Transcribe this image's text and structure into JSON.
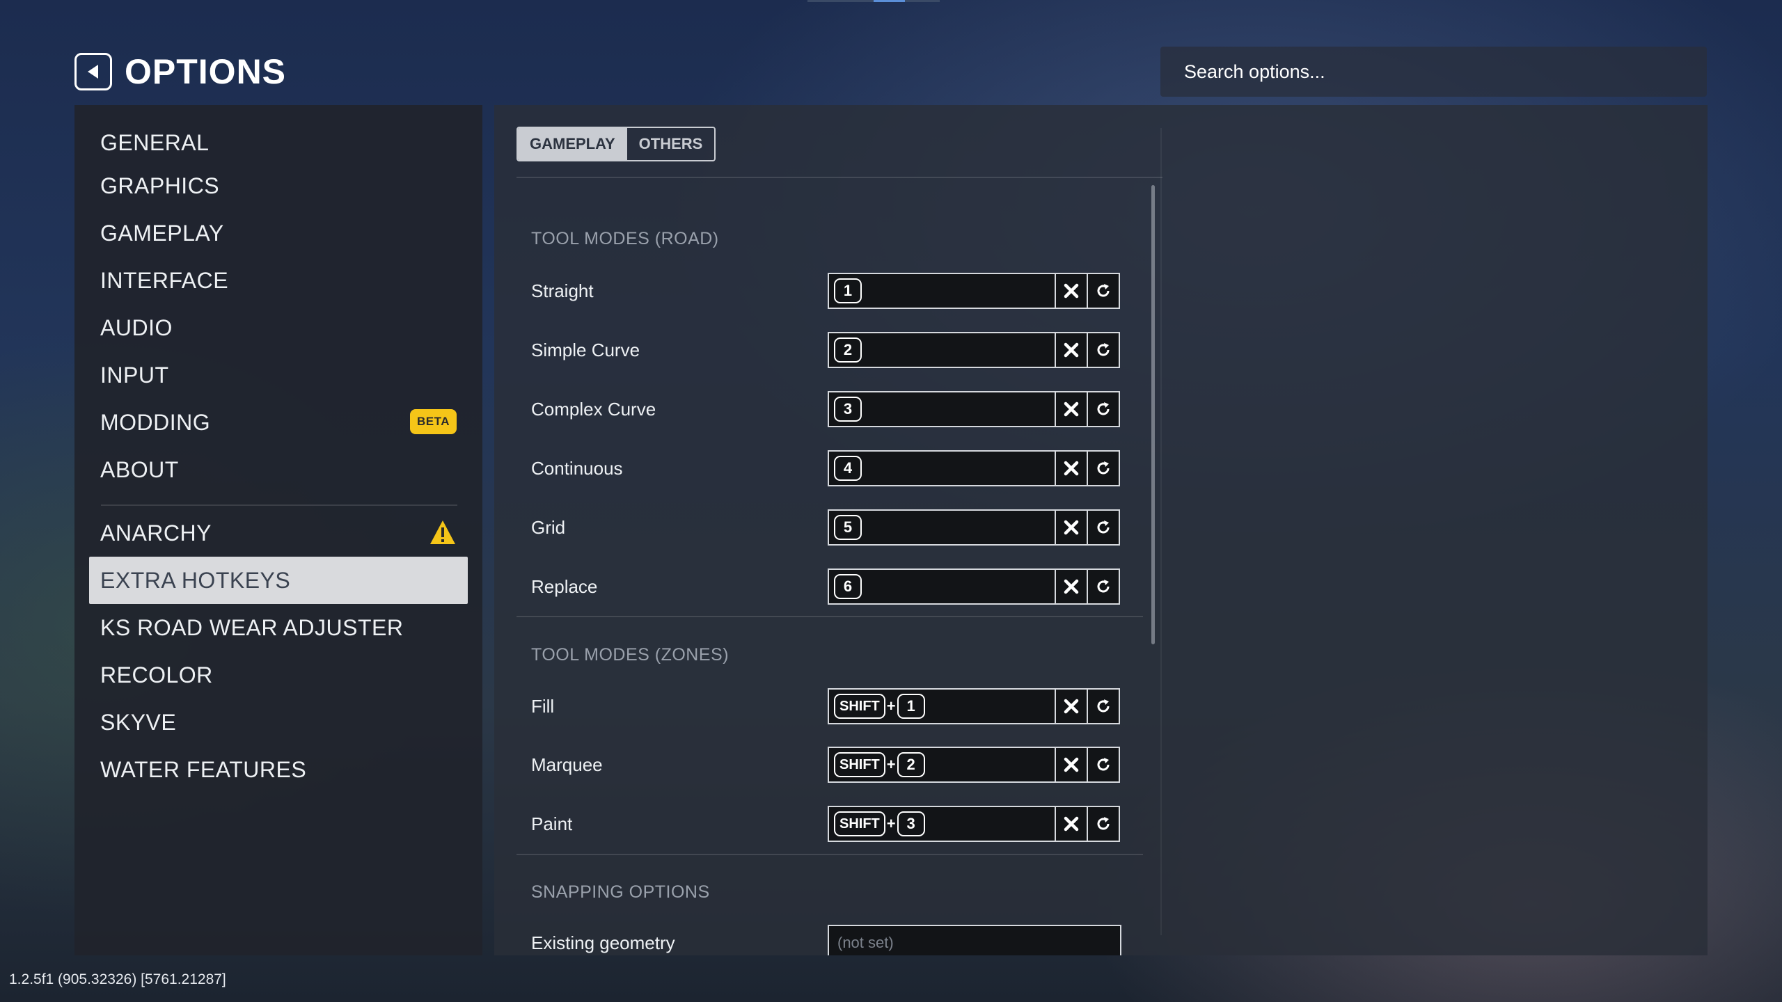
{
  "header": {
    "title": "OPTIONS",
    "back_icon": "back-arrow-icon"
  },
  "search": {
    "placeholder": "Search options..."
  },
  "sidebar": {
    "items": [
      {
        "label": "GENERAL"
      },
      {
        "label": "GRAPHICS"
      },
      {
        "label": "GAMEPLAY"
      },
      {
        "label": "INTERFACE"
      },
      {
        "label": "AUDIO"
      },
      {
        "label": "INPUT"
      },
      {
        "label": "MODDING",
        "badge": "BETA"
      },
      {
        "label": "ABOUT"
      },
      {
        "label": "ANARCHY",
        "icon": "warning-icon"
      },
      {
        "label": "EXTRA HOTKEYS",
        "active": true
      },
      {
        "label": "KS ROAD WEAR ADJUSTER"
      },
      {
        "label": "RECOLOR"
      },
      {
        "label": "SKYVE"
      },
      {
        "label": "WATER FEATURES"
      }
    ]
  },
  "tabs": [
    {
      "label": "GAMEPLAY",
      "selected": true
    },
    {
      "label": "OTHERS",
      "selected": false
    }
  ],
  "sections": {
    "road": {
      "title": "TOOL MODES (ROAD)",
      "rows": [
        {
          "label": "Straight",
          "key": "1"
        },
        {
          "label": "Simple Curve",
          "key": "2"
        },
        {
          "label": "Complex Curve",
          "key": "3"
        },
        {
          "label": "Continuous",
          "key": "4"
        },
        {
          "label": "Grid",
          "key": "5"
        },
        {
          "label": "Replace",
          "key": "6"
        }
      ]
    },
    "zones": {
      "title": "TOOL MODES (ZONES)",
      "rows": [
        {
          "label": "Fill",
          "modifier": "SHIFT",
          "plus": "+",
          "key": "1"
        },
        {
          "label": "Marquee",
          "modifier": "SHIFT",
          "plus": "+",
          "key": "2"
        },
        {
          "label": "Paint",
          "modifier": "SHIFT",
          "plus": "+",
          "key": "3"
        }
      ]
    },
    "snapping": {
      "title": "SNAPPING OPTIONS",
      "rows": [
        {
          "label": "Existing geometry",
          "value": "(not set)"
        }
      ]
    }
  },
  "footer": {
    "version": "1.2.5f1 (905.32326) [5761.21287]"
  },
  "colors": {
    "beta_badge": "#f5c518",
    "warning": "#f5c518",
    "active_item_bg": "#d9dadd"
  }
}
